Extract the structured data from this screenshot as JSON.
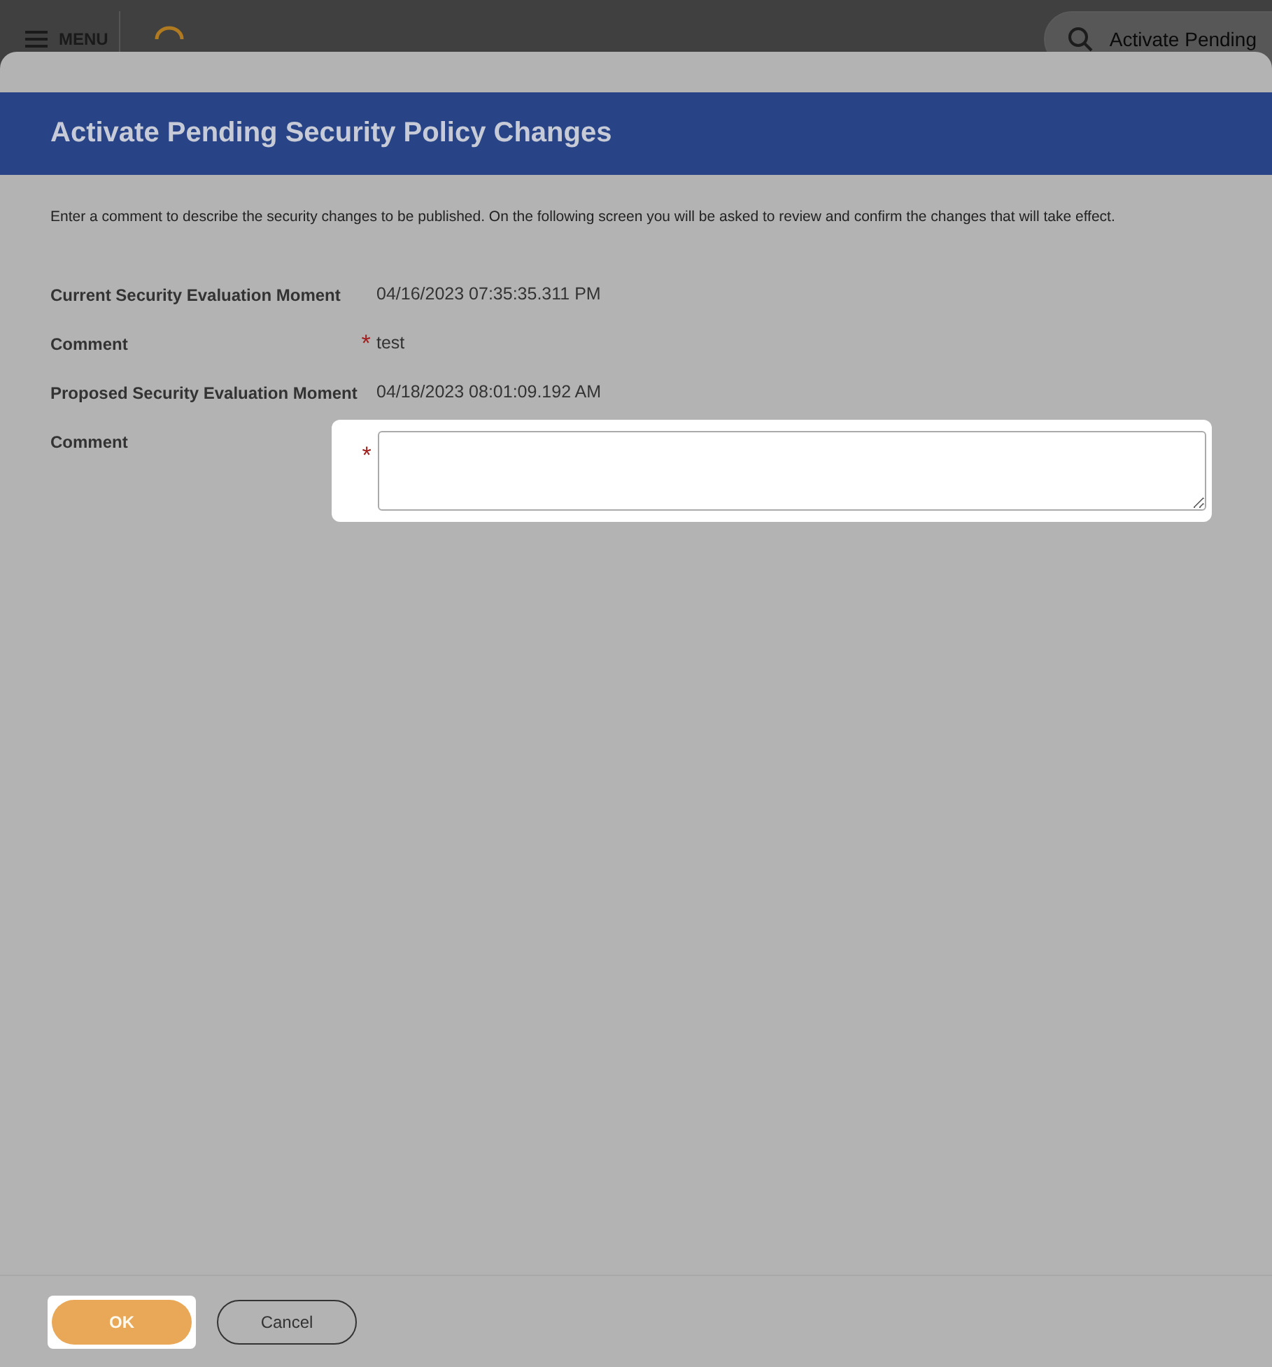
{
  "top_bar": {
    "menu_label": "MENU",
    "search_value": "Activate Pending"
  },
  "dialog": {
    "title": "Activate Pending Security Policy Changes",
    "required_mark": "*",
    "instructions": "Enter a comment to describe the security changes to be published. On the following screen you will be asked to review and confirm the changes that will take effect.",
    "fields": [
      {
        "kind": "static",
        "label": "Current Security Evaluation Moment",
        "required": false,
        "value": "04/16/2023 07:35:35.311 PM"
      },
      {
        "kind": "static",
        "label": "Comment",
        "required": true,
        "value": "test"
      },
      {
        "kind": "static",
        "label": "Proposed Security Evaluation Moment",
        "required": false,
        "value": "04/18/2023 08:01:09.192 AM"
      },
      {
        "kind": "textarea",
        "label": "Comment",
        "required": true,
        "highlighted": true
      }
    ],
    "buttons": [
      {
        "kind": "primary",
        "label": "OK",
        "highlighted": true
      },
      {
        "kind": "secondary",
        "label": "Cancel",
        "highlighted": false
      }
    ]
  }
}
